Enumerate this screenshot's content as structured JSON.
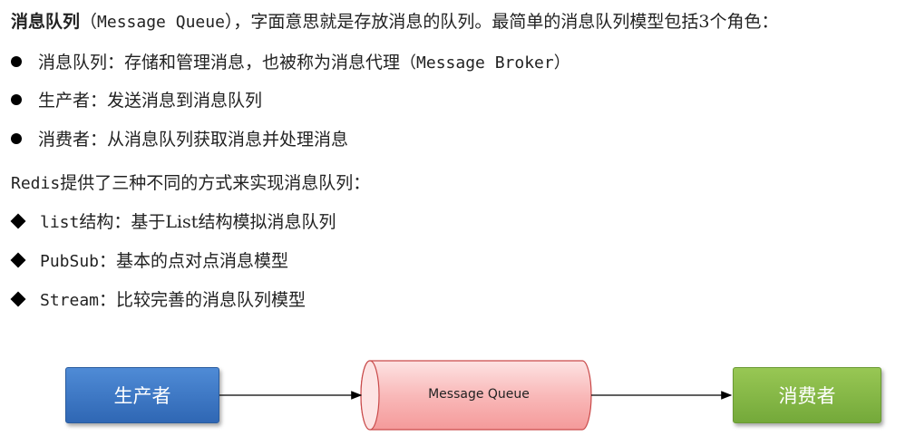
{
  "intro": {
    "term": "消息队列",
    "paren_open": "（",
    "term_en": "Message Queue",
    "rest": "），字面意思就是存放消息的队列。最简单的消息队列模型包括3个角色："
  },
  "roles": [
    {
      "label": "消息队列：存储和管理消息，也被称为消息代理",
      "paren": "（Message Broker）"
    },
    {
      "label": "生产者：发送消息到消息队列",
      "paren": ""
    },
    {
      "label": "消费者：从消息队列获取消息并处理消息",
      "paren": ""
    }
  ],
  "redis_intro": {
    "prefix": "Redis",
    "text": "提供了三种不同的方式来实现消息队列："
  },
  "methods": [
    {
      "name": "list",
      "desc": "结构：基于List结构模拟消息队列"
    },
    {
      "name": "PubSub",
      "desc": "：基本的点对点消息模型"
    },
    {
      "name": "Stream",
      "desc": "：比较完善的消息队列模型"
    }
  ],
  "diagram": {
    "producer_label": "生产者",
    "queue_label": "Message Queue",
    "consumer_label": "消费者",
    "colors": {
      "producer": "#3a74c4",
      "queue": "#f7a3a3",
      "consumer": "#86b946"
    }
  }
}
